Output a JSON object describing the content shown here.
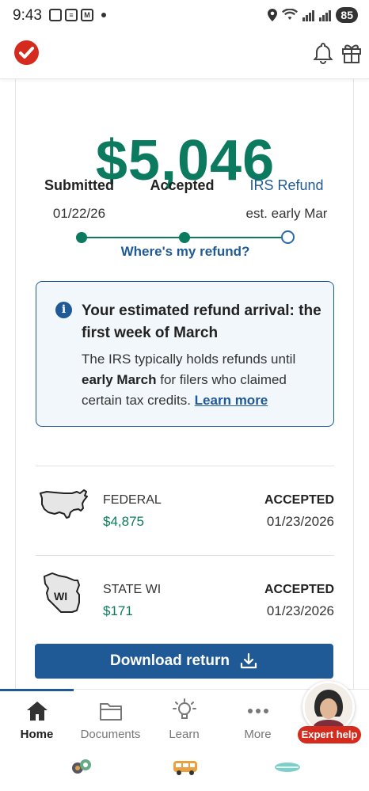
{
  "status_bar": {
    "time": "9:43",
    "battery": "85"
  },
  "refund": {
    "amount": "$5,046"
  },
  "progress": {
    "steps": [
      {
        "label": "Submitted",
        "date": "01/22/26",
        "state": "complete"
      },
      {
        "label": "Accepted",
        "date": "",
        "state": "complete"
      },
      {
        "label": "IRS Refund",
        "date": "est. early Mar",
        "state": "pending"
      }
    ]
  },
  "wheres_refund_link": "Where's my refund?",
  "info": {
    "title": "Your estimated refund arrival: the first week of March",
    "body_1": "The IRS typically holds refunds until ",
    "body_bold": "early March",
    "body_2": " for filers who claimed certain tax credits. ",
    "link": "Learn more"
  },
  "returns": [
    {
      "name": "FEDERAL",
      "amount": "$4,875",
      "status": "ACCEPTED",
      "date": "01/23/2026"
    },
    {
      "name": "STATE WI",
      "amount": "$171",
      "status": "ACCEPTED",
      "date": "01/23/2026",
      "map_label": "WI"
    }
  ],
  "download_button": "Download return",
  "nav": [
    {
      "label": "Home",
      "icon": "home-icon",
      "active": true
    },
    {
      "label": "Documents",
      "icon": "folder-icon",
      "active": false
    },
    {
      "label": "Learn",
      "icon": "lightbulb-icon",
      "active": false
    },
    {
      "label": "More",
      "icon": "more-icon",
      "active": false
    }
  ],
  "expert_help": "Expert help",
  "colors": {
    "brand_green": "#0b7a5f",
    "brand_blue": "#1f5a97",
    "brand_red": "#d52b1e"
  }
}
